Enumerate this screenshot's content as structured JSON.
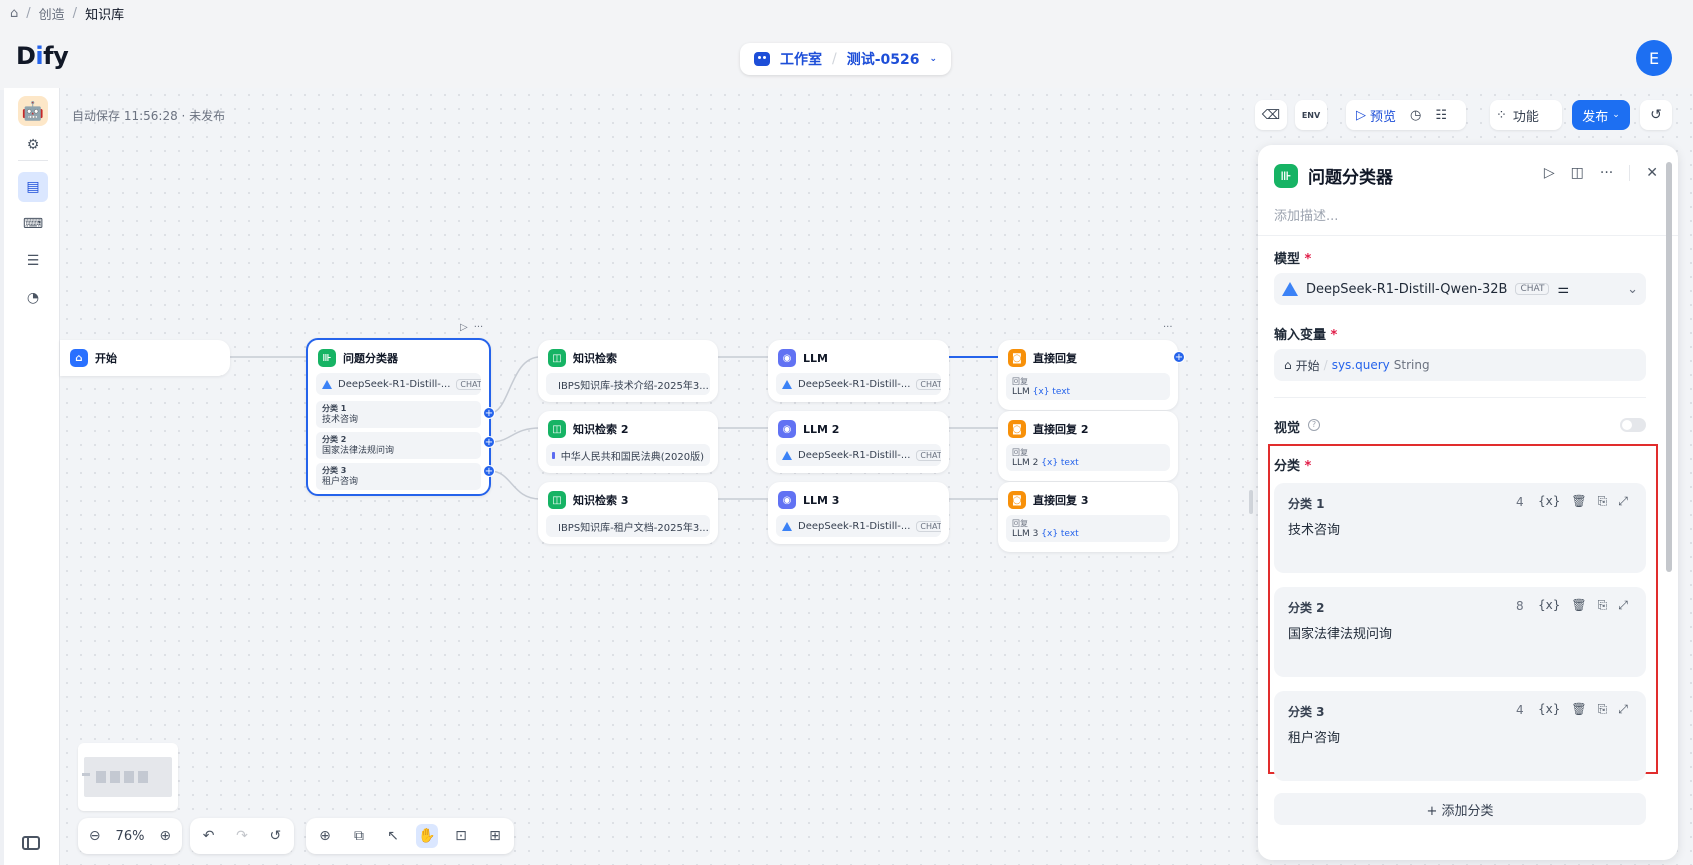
{
  "breadcrumb": {
    "items": [
      "创造",
      "知识库"
    ]
  },
  "header": {
    "logo": {
      "pre": "D",
      "i": "i",
      "post": "fy"
    },
    "workspace": "工作室",
    "app_name": "测试-0526",
    "avatar": "E"
  },
  "canvas": {
    "autosave": "自动保存 11:56:28 · 未发布",
    "zoom": "76%"
  },
  "toolbar": {
    "env": "ENV",
    "preview": "预览",
    "features": "功能",
    "publish": "发布"
  },
  "nodes": {
    "start": {
      "title": "开始"
    },
    "classifier": {
      "title": "问题分类器",
      "model": "DeepSeek-R1-Distill-...",
      "model_tag": "CHAT",
      "classes": [
        {
          "name": "分类 1",
          "text": "技术咨询"
        },
        {
          "name": "分类 2",
          "text": "国家法律法规问询"
        },
        {
          "name": "分类 3",
          "text": "租户咨询"
        }
      ]
    },
    "kr1": {
      "title": "知识检索",
      "dataset": "IBPS知识库-技术介绍-2025年3..."
    },
    "kr2": {
      "title": "知识检索 2",
      "dataset": "中华人民共和国民法典(2020版)"
    },
    "kr3": {
      "title": "知识检索 3",
      "dataset": "IBPS知识库-租户文档-2025年3..."
    },
    "llm1": {
      "title": "LLM",
      "model": "DeepSeek-R1-Distill-...",
      "tag": "CHAT"
    },
    "llm2": {
      "title": "LLM 2",
      "model": "DeepSeek-R1-Distill-...",
      "tag": "CHAT"
    },
    "llm3": {
      "title": "LLM 3",
      "model": "DeepSeek-R1-Distill-...",
      "tag": "CHAT"
    },
    "ans1": {
      "title": "直接回复",
      "reply_label": "回复",
      "src": "LLM",
      "var": "{x} text"
    },
    "ans2": {
      "title": "直接回复 2",
      "reply_label": "回复",
      "src": "LLM 2",
      "var": "{x} text"
    },
    "ans3": {
      "title": "直接回复 3",
      "reply_label": "回复",
      "src": "LLM 3",
      "var": "{x} text"
    }
  },
  "panel": {
    "title": "问题分类器",
    "description_placeholder": "添加描述...",
    "model_label": "模型",
    "model_name": "DeepSeek-R1-Distill-Qwen-32B",
    "model_tag": "CHAT",
    "input_label": "输入变量",
    "input_node": "开始",
    "input_var": "sys.query",
    "input_type": "String",
    "vision_label": "视觉",
    "classes_label": "分类",
    "required_mark": "*",
    "classes": [
      {
        "name": "分类 1",
        "count": "4",
        "text": "技术咨询"
      },
      {
        "name": "分类 2",
        "count": "8",
        "text": "国家法律法规问询"
      },
      {
        "name": "分类 3",
        "count": "4",
        "text": "租户咨询"
      }
    ],
    "add_class": "+ 添加分类"
  },
  "icons": {
    "var_icon": "{x}"
  },
  "colors": {
    "accent": "#2563eb",
    "highlight": "#e12d2d"
  }
}
